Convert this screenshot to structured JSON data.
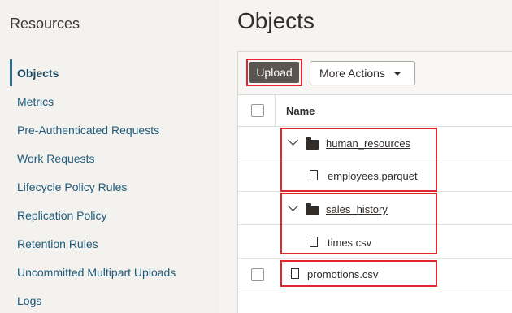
{
  "sidebar": {
    "title": "Resources",
    "items": [
      {
        "label": "Objects"
      },
      {
        "label": "Metrics"
      },
      {
        "label": "Pre-Authenticated Requests"
      },
      {
        "label": "Work Requests"
      },
      {
        "label": "Lifecycle Policy Rules"
      },
      {
        "label": "Replication Policy"
      },
      {
        "label": "Retention Rules"
      },
      {
        "label": "Uncommitted Multipart Uploads"
      },
      {
        "label": "Logs"
      }
    ],
    "active_index": 0
  },
  "main": {
    "title": "Objects",
    "toolbar": {
      "upload_label": "Upload",
      "more_actions_label": "More Actions"
    },
    "table": {
      "column_name": "Name",
      "rows": [
        {
          "type": "folder",
          "name": "human_resources",
          "expanded": true
        },
        {
          "type": "file",
          "name": "employees.parquet",
          "parent": "human_resources"
        },
        {
          "type": "folder",
          "name": "sales_history",
          "expanded": true
        },
        {
          "type": "file",
          "name": "times.csv",
          "parent": "sales_history"
        },
        {
          "type": "file",
          "name": "promotions.csv"
        }
      ]
    }
  },
  "colors": {
    "highlight": "#e3262b",
    "link": "#1f5b7a",
    "upload_bg": "#5a5550"
  }
}
